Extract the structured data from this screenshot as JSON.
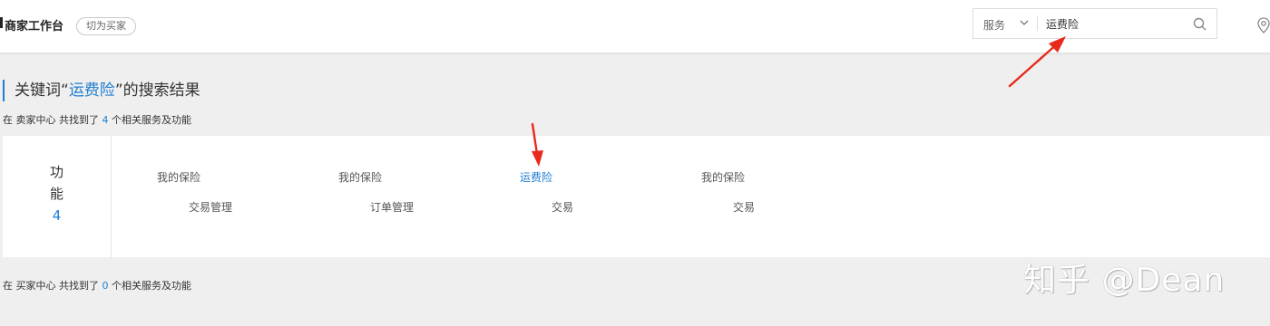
{
  "header": {
    "brand": "商家工作台",
    "switch_label": "切为买家",
    "search": {
      "scope": "服务",
      "value": "运费险"
    }
  },
  "results": {
    "heading": {
      "prefix": "关键词“",
      "keyword": "运费险",
      "suffix": "”的搜索结果"
    },
    "seller_summary": {
      "prefix": "在 卖家中心 共找到了 ",
      "count": "4",
      "suffix": " 个相关服务及功能"
    },
    "panel": {
      "char1": "功",
      "char2": "能",
      "count": "4",
      "items": [
        {
          "title": "我的保险",
          "category": "交易管理"
        },
        {
          "title": "我的保险",
          "category": "订单管理"
        },
        {
          "title": "运费险",
          "category": "交易"
        },
        {
          "title": "我的保险",
          "category": "交易"
        }
      ]
    },
    "buyer_summary": {
      "prefix": "在 买家中心 共找到了 ",
      "count": "0",
      "suffix": " 个相关服务及功能"
    }
  },
  "watermark": "知乎 @Dean",
  "colors": {
    "accent": "#1f7ed0",
    "annotation_arrow": "#e8291c",
    "background": "#efefef"
  },
  "icons": [
    "search-icon",
    "chevron-down-icon",
    "location-icon",
    "annotation-arrow"
  ]
}
